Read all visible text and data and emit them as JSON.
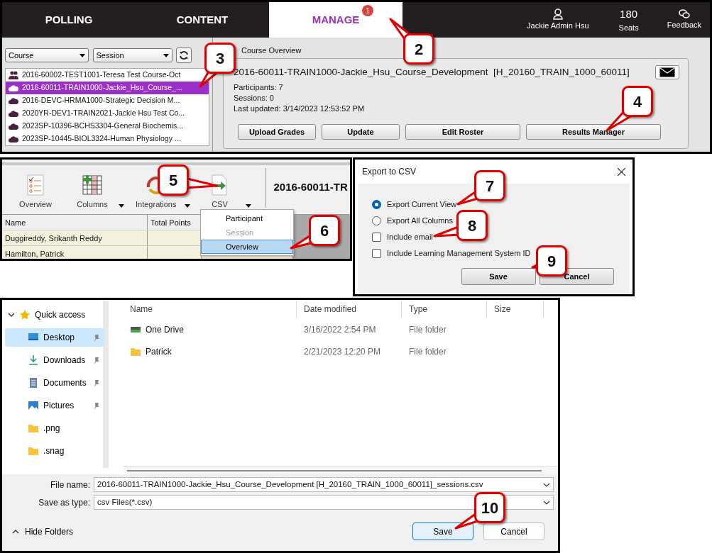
{
  "nav": {
    "tabs": [
      {
        "label": "POLLING",
        "selected": false
      },
      {
        "label": "CONTENT",
        "selected": false
      },
      {
        "label": "MANAGE",
        "selected": true,
        "badge": "1"
      }
    ],
    "user": "Jackie Admin Hsu",
    "seats": {
      "count": "180",
      "label": "Seats"
    },
    "feedback": "Feedback"
  },
  "course_panel": {
    "filters": [
      "Course",
      "Session"
    ],
    "courses": [
      {
        "label": "2016-60002-TEST1001-Teresa Test Course-Oct",
        "kind": "group",
        "selected": false
      },
      {
        "label": "2016-60011-TRAIN1000-Jackie_Hsu_Course_...",
        "kind": "cloud",
        "selected": true
      },
      {
        "label": "2016-DEVC-HRMA1000-Strategic Decision M...",
        "kind": "cloud",
        "selected": false
      },
      {
        "label": "2020YR-DEV1-TRAIN2021-Jackie Hsu Test Co...",
        "kind": "cloud",
        "selected": false
      },
      {
        "label": "2023SP-10396-BCHS3304-General Biochemis...",
        "kind": "cloud",
        "selected": false
      },
      {
        "label": "2023SP-10445-BIOL3324-Human Physiology ...",
        "kind": "cloud",
        "selected": false
      }
    ]
  },
  "overview": {
    "section_label": "Course Overview",
    "title": "2016-60011-TRAIN1000-Jackie_Hsu_Course_Development  [H_20160_TRAIN_1000_60011]",
    "details": [
      "Participants: 7",
      "Sessions: 0",
      "Last updated: 3/14/2023 12:53:52 PM"
    ],
    "buttons": [
      "Upload Grades",
      "Update",
      "Edit Roster",
      "Results Manager"
    ]
  },
  "results": {
    "toolbar": [
      {
        "label": "Overview",
        "kind": "overview",
        "dropdown": false
      },
      {
        "label": "Columns",
        "kind": "columns",
        "dropdown": true
      },
      {
        "label": "Integrations",
        "kind": "integrations",
        "dropdown": true
      },
      {
        "label": "CSV",
        "kind": "csv",
        "dropdown": true
      }
    ],
    "title": "2016-60011-TR",
    "columns": [
      "Name",
      "Total Points"
    ],
    "rows": [
      {
        "name": "Duggireddy, Srikanth Reddy"
      },
      {
        "name": "Hamilton, Patrick"
      }
    ],
    "csv_menu": [
      {
        "label": "Participant",
        "disabled": false,
        "selected": false
      },
      {
        "label": "Session",
        "disabled": true,
        "selected": false
      },
      {
        "label": "Overview",
        "disabled": false,
        "selected": true
      }
    ]
  },
  "export_dialog": {
    "title": "Export to CSV",
    "options": [
      {
        "kind": "radio",
        "label": "Export Current View",
        "checked": true
      },
      {
        "kind": "radio",
        "label": "Export All Columns",
        "checked": false
      },
      {
        "kind": "checkbox",
        "label": "Include email",
        "checked": false
      },
      {
        "kind": "checkbox",
        "label": "Include Learning Management System ID",
        "checked": false
      }
    ],
    "buttons": [
      "Save",
      "Cancel"
    ]
  },
  "save_dialog": {
    "nav": [
      {
        "label": "Quick access",
        "expanded": true,
        "children": [
          {
            "label": "Desktop",
            "kind": "desktop",
            "selected": true,
            "pinned": true
          },
          {
            "label": "Downloads",
            "kind": "downloads",
            "selected": false,
            "pinned": true
          },
          {
            "label": "Documents",
            "kind": "documents",
            "selected": false,
            "pinned": true
          },
          {
            "label": "Pictures",
            "kind": "pictures",
            "selected": false,
            "pinned": true
          },
          {
            "label": ".png",
            "kind": "folder",
            "selected": false,
            "pinned": false
          },
          {
            "label": ".snag",
            "kind": "folder",
            "selected": false,
            "pinned": false
          }
        ]
      }
    ],
    "columns": [
      "Name",
      "Date modified",
      "Type",
      "Size"
    ],
    "files": [
      {
        "name": "One Drive",
        "kind": "drive",
        "modified": "3/16/2022 2:54 PM",
        "type": "File folder"
      },
      {
        "name": "Patrick",
        "kind": "folder",
        "modified": "2/21/2023 12:20 PM",
        "type": "File folder"
      }
    ],
    "file_name": {
      "label": "File name:",
      "value": "2016-60011-TRAIN1000-Jackie_Hsu_Course_Development  [H_20160_TRAIN_1000_60011]_sessions.csv"
    },
    "save_type": {
      "label": "Save as type:",
      "value": "csv Files(*.csv)"
    },
    "hide_folders": "Hide Folders",
    "buttons": [
      "Save",
      "Cancel"
    ]
  },
  "callouts": [
    "2",
    "3",
    "4",
    "5",
    "6",
    "7",
    "8",
    "9",
    "10"
  ]
}
